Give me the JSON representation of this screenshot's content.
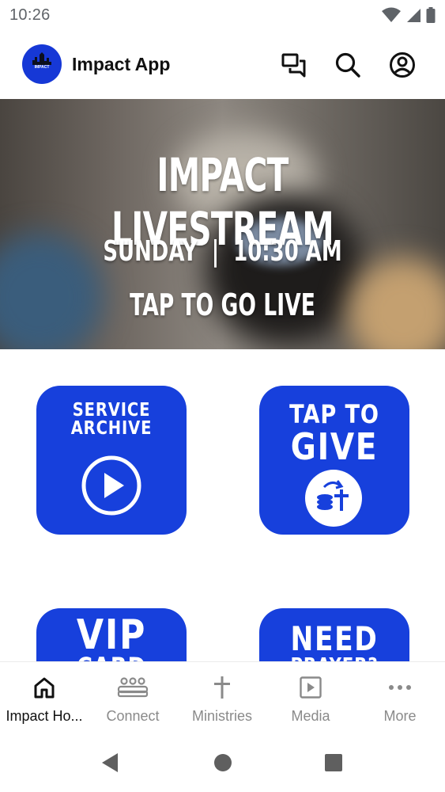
{
  "status_bar": {
    "time": "10:26"
  },
  "header": {
    "title": "Impact App",
    "logo_text": "IMPACT"
  },
  "hero": {
    "title": "IMPACT LIVESTREAM",
    "schedule": "SUNDAY  |  10:30 AM",
    "cta": "TAP TO GO LIVE"
  },
  "tiles": [
    {
      "line1": "SERVICE",
      "line2": "ARCHIVE",
      "icon": "play-circle-icon"
    },
    {
      "line1": "TAP TO",
      "line2": "GIVE",
      "icon": "give-coins-icon"
    },
    {
      "line1": "VIP",
      "line2": "CARD",
      "icon": ""
    },
    {
      "line1": "NEED",
      "line2": "PRAYER?",
      "icon": ""
    }
  ],
  "bottom_nav": [
    {
      "label": "Impact Ho...",
      "icon": "home-icon",
      "active": true
    },
    {
      "label": "Connect",
      "icon": "people-icon",
      "active": false
    },
    {
      "label": "Ministries",
      "icon": "cross-icon",
      "active": false
    },
    {
      "label": "Media",
      "icon": "media-icon",
      "active": false
    },
    {
      "label": "More",
      "icon": "more-icon",
      "active": false
    }
  ],
  "colors": {
    "brand_blue": "#1740dc",
    "inactive_nav": "#8a8a8a"
  }
}
